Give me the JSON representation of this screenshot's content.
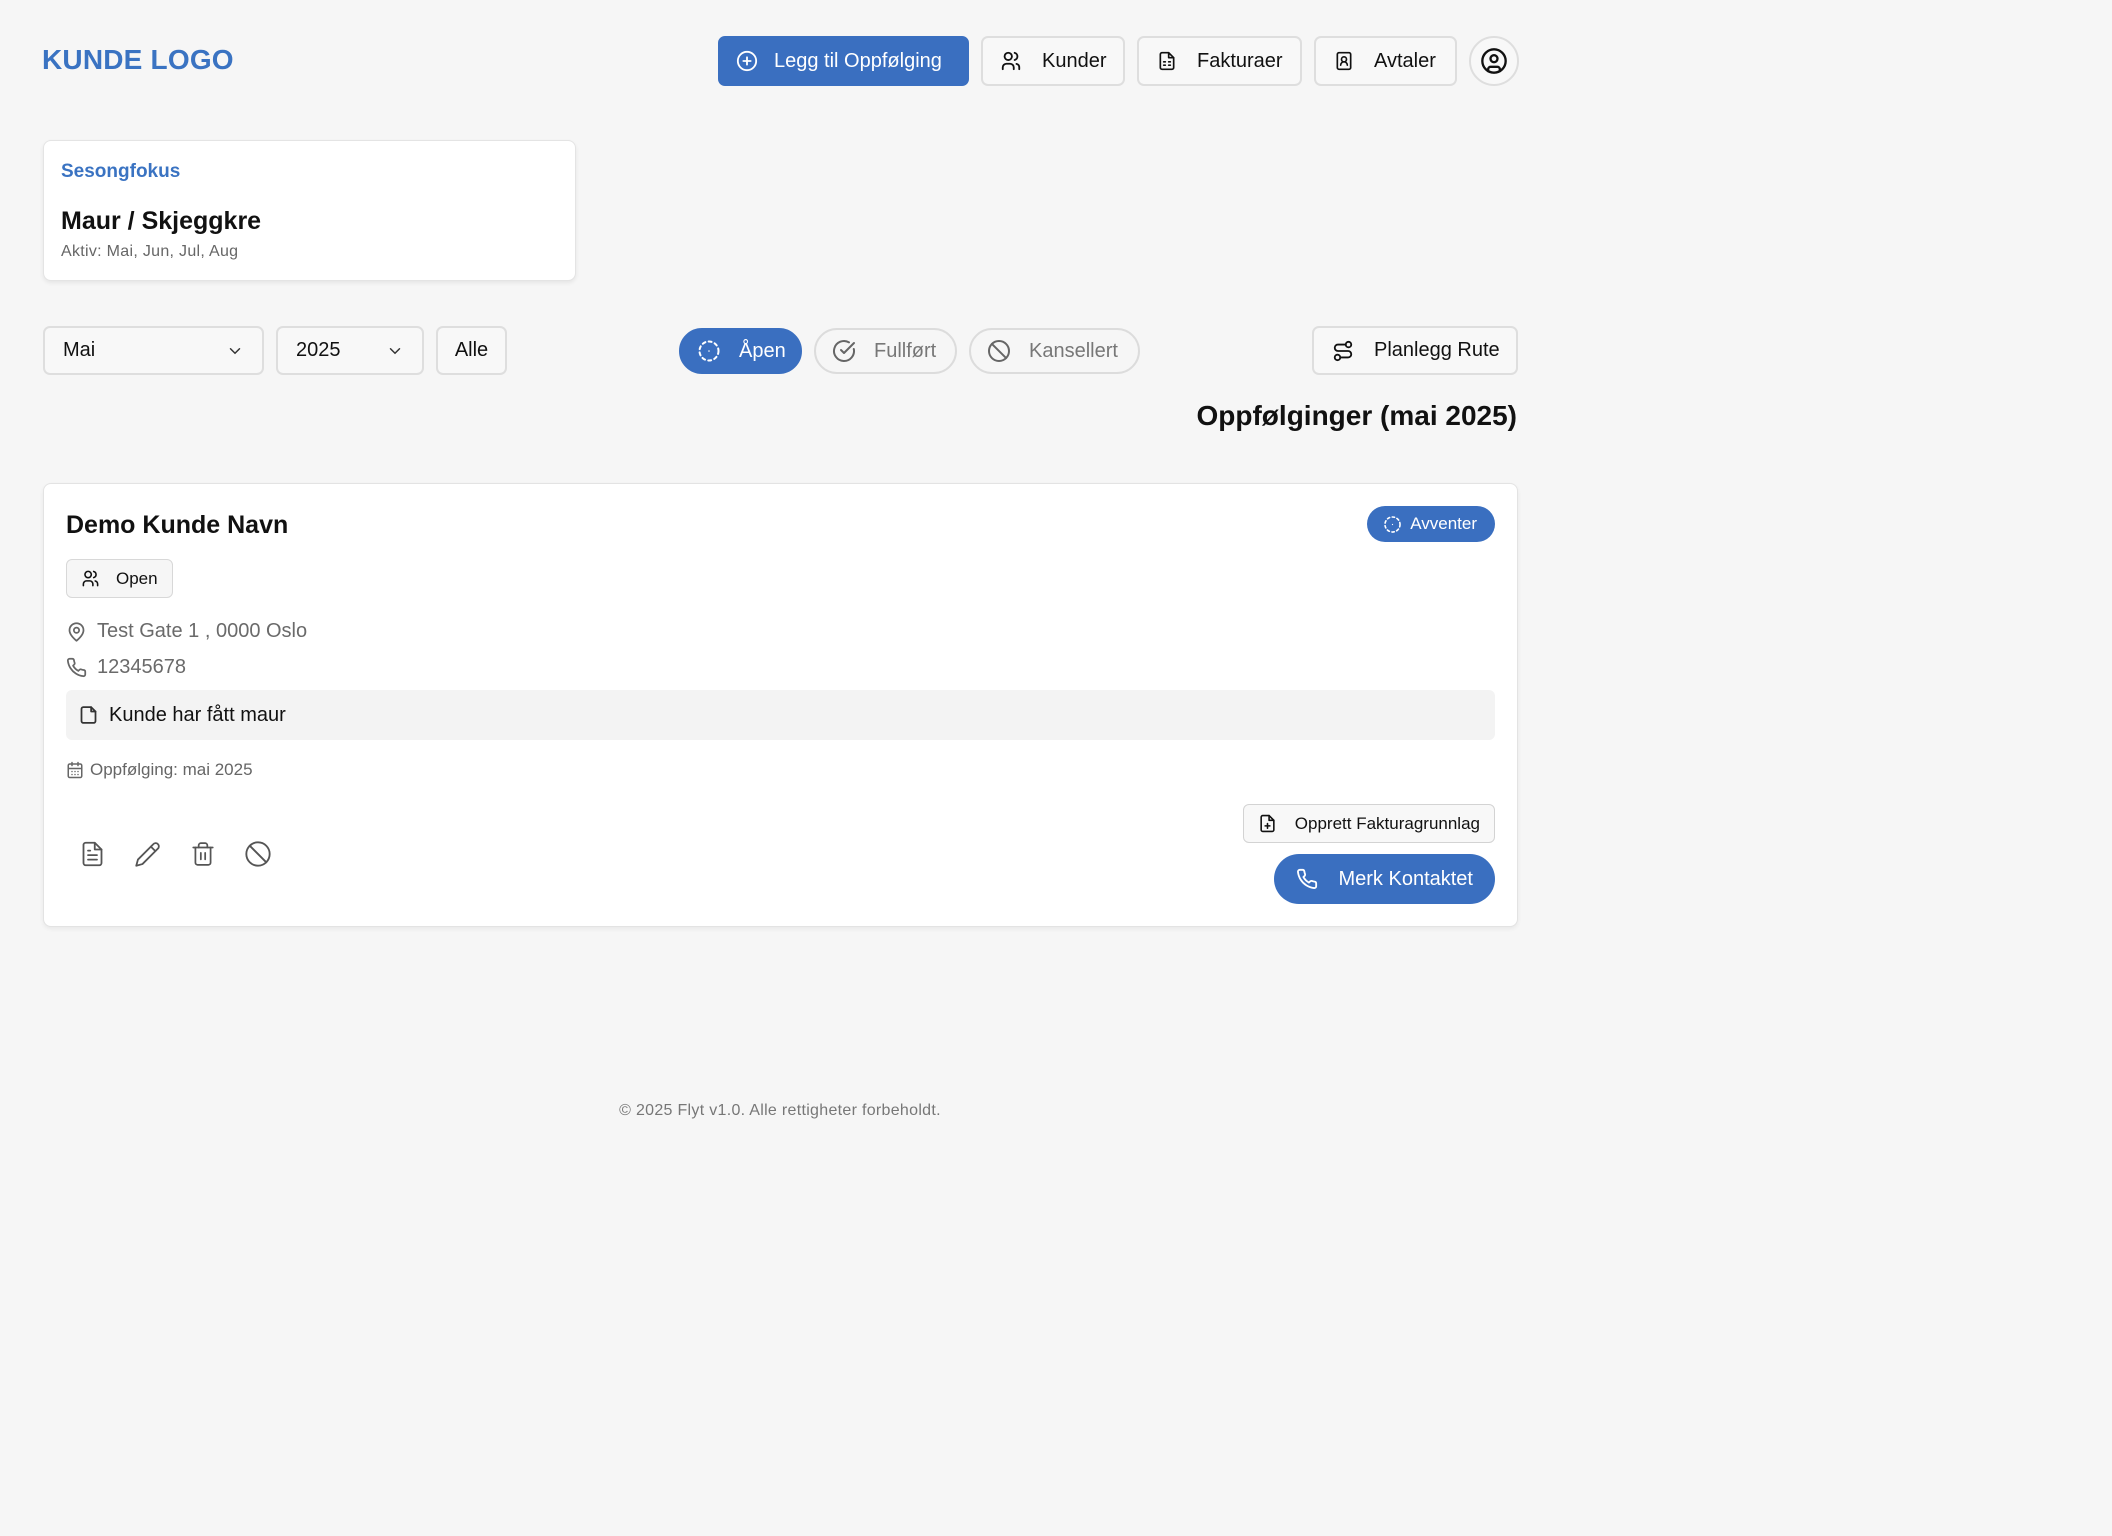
{
  "header": {
    "logo": "KUNDE LOGO",
    "add_followup_label": "Legg til Oppfølging",
    "customers_label": "Kunder",
    "invoices_label": "Fakturaer",
    "agreements_label": "Avtaler"
  },
  "season": {
    "eyebrow": "Sesongfokus",
    "title": "Maur / Skjeggkre",
    "active": "Aktiv: Mai, Jun, Jul, Aug"
  },
  "filters": {
    "month": "Mai",
    "year": "2025",
    "all_label": "Alle",
    "status_open": "Åpen",
    "status_done": "Fullført",
    "status_cancelled": "Kansellert",
    "active_status": "Åpen",
    "plan_route_label": "Planlegg Rute"
  },
  "list": {
    "title": "Oppfølginger (mai 2025)"
  },
  "followup": {
    "customer_name": "Demo Kunde Navn",
    "status": "Avventer",
    "tag": "Open",
    "address": "Test Gate 1 , 0000 Oslo",
    "phone": "12345678",
    "note": "Kunde har fått maur",
    "followup_date": "Oppfølging: mai 2025",
    "create_invoice_label": "Opprett Fakturagrunnlag",
    "mark_contacted_label": "Merk Kontaktet"
  },
  "footer": {
    "text": "© 2025 Flyt v1.0. Alle rettigheter forbeholdt."
  },
  "colors": {
    "primary": "#3a6fc0",
    "background": "#f6f6f6",
    "card": "#ffffff",
    "muted_text": "#6a6a6a"
  },
  "icons": [
    "plus-circle-icon",
    "users-icon",
    "file-text-icon",
    "contact-book-icon",
    "user-circle-icon",
    "chevron-down-icon",
    "loader-circle-icon",
    "check-circle-icon",
    "ban-icon",
    "route-icon",
    "map-pin-icon",
    "phone-icon",
    "file-icon",
    "calendar-icon",
    "pencil-icon",
    "trash-icon",
    "file-plus-icon"
  ]
}
